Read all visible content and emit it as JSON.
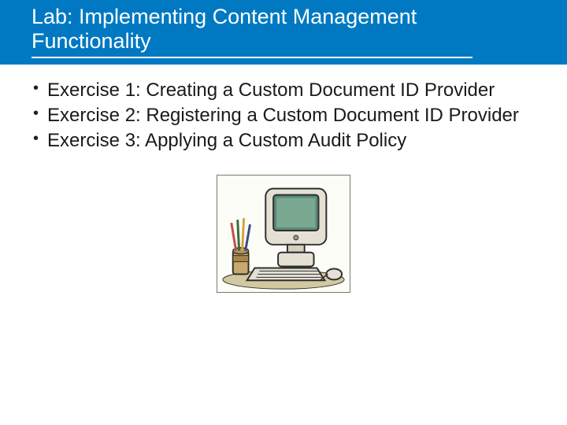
{
  "header": {
    "title": "Lab: Implementing Content Management Functionality"
  },
  "bullets": [
    {
      "text": "Exercise 1: Creating a Custom Document ID Provider"
    },
    {
      "text": "Exercise 2: Registering a Custom Document ID Provider"
    },
    {
      "text": "Exercise 3: Applying a Custom Audit Policy"
    }
  ]
}
